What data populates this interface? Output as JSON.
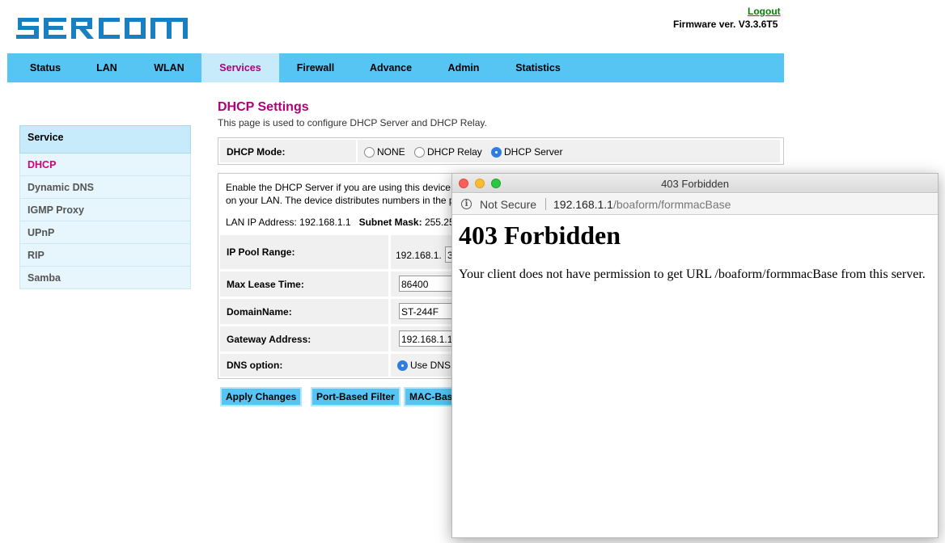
{
  "header": {
    "logo_text": "SERCOM",
    "logout": "Logout",
    "firmware": "Firmware ver. V3.3.6T5"
  },
  "topnav": {
    "tabs": [
      {
        "label": "Status"
      },
      {
        "label": "LAN"
      },
      {
        "label": "WLAN"
      },
      {
        "label": "Services",
        "active": true
      },
      {
        "label": "Firewall"
      },
      {
        "label": "Advance"
      },
      {
        "label": "Admin"
      },
      {
        "label": "Statistics"
      }
    ]
  },
  "sidebar": {
    "heading": "Service",
    "items": [
      {
        "label": "DHCP",
        "active": true
      },
      {
        "label": "Dynamic DNS"
      },
      {
        "label": "IGMP Proxy"
      },
      {
        "label": "UPnP"
      },
      {
        "label": "RIP"
      },
      {
        "label": "Samba"
      }
    ]
  },
  "main": {
    "title": "DHCP Settings",
    "description": "This page is used to configure DHCP Server and DHCP Relay.",
    "dhcp_mode": {
      "label": "DHCP Mode:",
      "options": [
        "NONE",
        "DHCP Relay",
        "DHCP Server"
      ],
      "selected": "DHCP Server"
    },
    "intro_line1": "Enable the DHCP Server if you are using this device",
    "intro_line2": "on your LAN. The device distributes numbers in the p",
    "lan_ip_label": "LAN IP Address:",
    "lan_ip_value": "192.168.1.1",
    "subnet_label": "Subnet Mask:",
    "subnet_value": "255.25",
    "ip_pool": {
      "label": "IP Pool Range:",
      "prefix": "192.168.1.",
      "start": "3"
    },
    "max_lease": {
      "label": "Max Lease Time:",
      "value": "86400"
    },
    "domain_name": {
      "label": "DomainName:",
      "value": "ST-244F"
    },
    "gateway": {
      "label": "Gateway Address:",
      "value": "192.168.1.1"
    },
    "dns_option": {
      "label": "DNS option:",
      "selected_label": "Use DNS"
    },
    "buttons": {
      "apply": "Apply Changes",
      "port_filter": "Port-Based Filter",
      "mac_filter": "MAC-Bas"
    }
  },
  "popup": {
    "window_title": "403 Forbidden",
    "not_secure": "Not Secure",
    "url_host": "192.168.1.1",
    "url_path": "/boaform/formmacBase",
    "heading": "403 Forbidden",
    "message": "Your client does not have permission to get URL /boaform/formmacBase from this server.",
    "colors": {
      "close": "#fc5f57",
      "minimize": "#fdbc2e",
      "zoom": "#28c840"
    }
  },
  "colors": {
    "nav": "#56c5f4",
    "accent": "#b0007a",
    "active_side": "#d4007f"
  }
}
